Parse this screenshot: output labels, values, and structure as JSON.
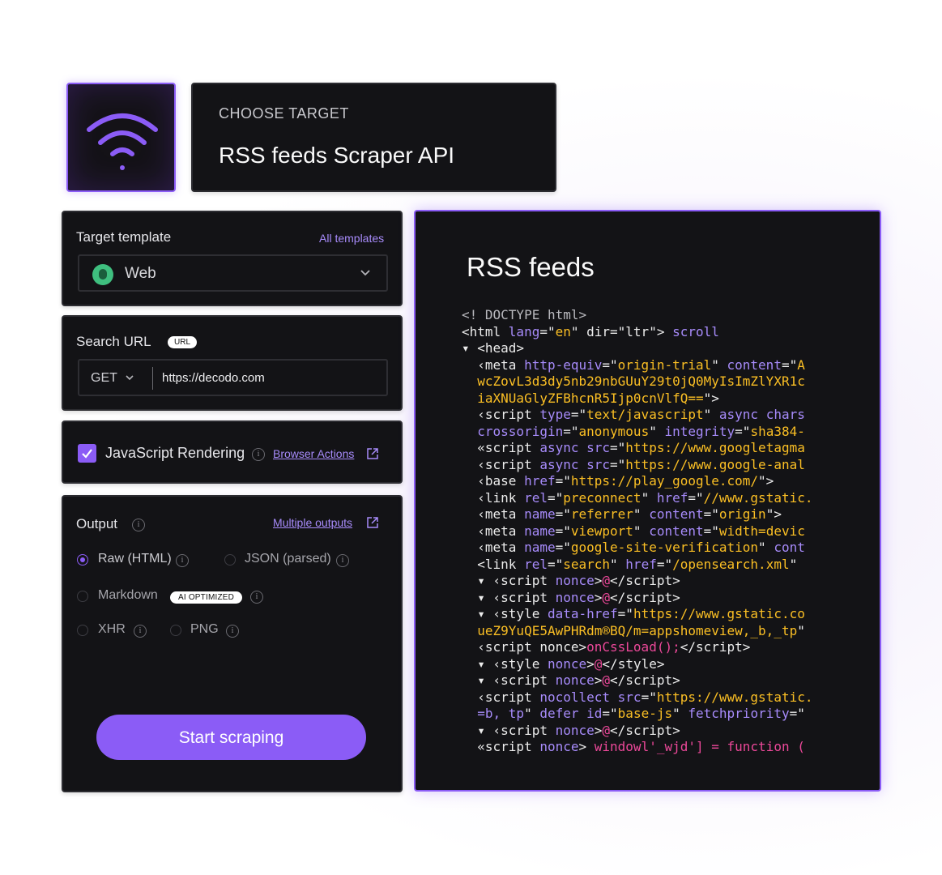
{
  "header": {
    "eyebrow": "CHOOSE TARGET",
    "title": "RSS feeds Scraper API",
    "icon": "wifi-icon"
  },
  "template": {
    "label": "Target template",
    "all_link": "All templates",
    "selected": "Web",
    "icon": "bug-icon"
  },
  "search_url": {
    "label": "Search URL",
    "badge": "URL",
    "method": "GET",
    "url": "https://decodo.com"
  },
  "js_rendering": {
    "label": "JavaScript Rendering",
    "checked": true,
    "link": "Browser Actions"
  },
  "output": {
    "label": "Output",
    "link": "Multiple outputs",
    "options": [
      {
        "label": "Raw (HTML)",
        "selected": true
      },
      {
        "label": "JSON (parsed)",
        "selected": false
      },
      {
        "label": "Markdown",
        "selected": false,
        "badge": "AI OPTIMIZED"
      },
      {
        "label": "XHR",
        "selected": false
      },
      {
        "label": "PNG",
        "selected": false
      }
    ],
    "button": "Start scraping"
  },
  "code_panel": {
    "title": "RSS feeds"
  },
  "colors": {
    "accent": "#8b5cf6",
    "card_bg": "#131316",
    "code_attr": "#a78bfa",
    "code_string": "#fbbf24",
    "code_pink": "#ec4899"
  }
}
